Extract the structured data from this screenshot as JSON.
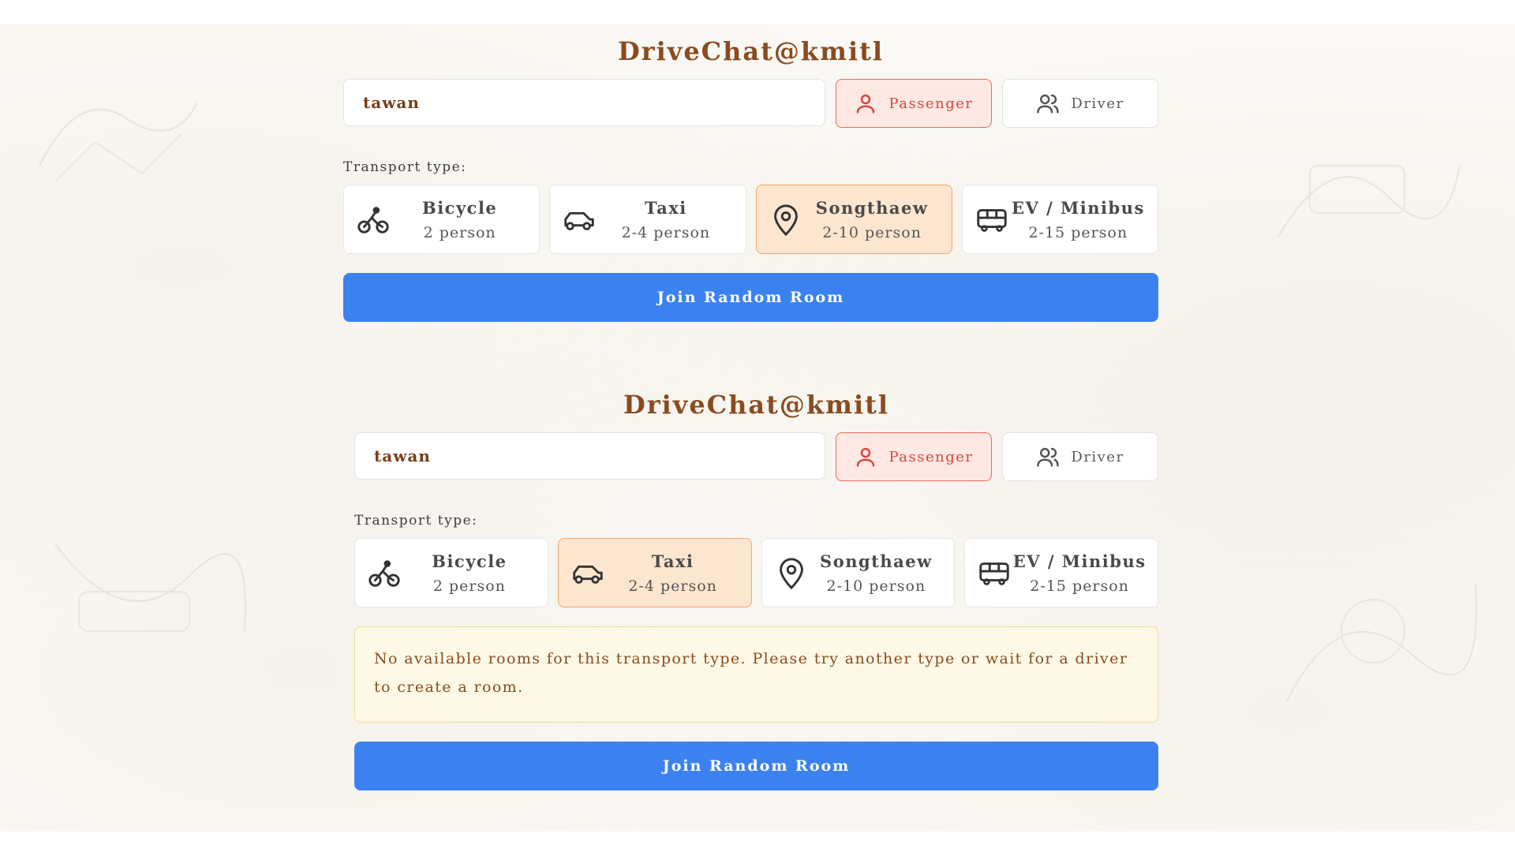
{
  "app_title": "DriveChat@kmitl",
  "colors": {
    "title": "#8a4b1f",
    "accent_blue": "#3b82f0",
    "passenger_active_bg": "#fde8e4",
    "passenger_active_border": "#ef6b5a",
    "transport_active_bg": "#fde6cf",
    "alert_bg": "#fef9e6"
  },
  "panels": [
    {
      "title": "DriveChat@kmitl",
      "name_value": "tawan",
      "roles": [
        {
          "label": "Passenger",
          "icon": "user-icon",
          "active": true
        },
        {
          "label": "Driver",
          "icon": "users-icon",
          "active": false
        }
      ],
      "transport_label": "Transport type:",
      "transports": [
        {
          "name": "Bicycle",
          "capacity": "2 person",
          "icon": "bicycle-icon",
          "active": false
        },
        {
          "name": "Taxi",
          "capacity": "2-4 person",
          "icon": "car-icon",
          "active": false
        },
        {
          "name": "Songthaew",
          "capacity": "2-10 person",
          "icon": "map-pin-icon",
          "active": true
        },
        {
          "name": "EV / Minibus",
          "capacity": "2-15 person",
          "icon": "bus-icon",
          "active": false
        }
      ],
      "join_label": "Join Random Room"
    },
    {
      "title": "DriveChat@kmitl",
      "name_value": "tawan",
      "roles": [
        {
          "label": "Passenger",
          "icon": "user-icon",
          "active": true
        },
        {
          "label": "Driver",
          "icon": "users-icon",
          "active": false
        }
      ],
      "transport_label": "Transport type:",
      "transports": [
        {
          "name": "Bicycle",
          "capacity": "2 person",
          "icon": "bicycle-icon",
          "active": false
        },
        {
          "name": "Taxi",
          "capacity": "2-4 person",
          "icon": "car-icon",
          "active": true
        },
        {
          "name": "Songthaew",
          "capacity": "2-10 person",
          "icon": "map-pin-icon",
          "active": false
        },
        {
          "name": "EV / Minibus",
          "capacity": "2-15 person",
          "icon": "bus-icon",
          "active": false
        }
      ],
      "alert_text": "No available rooms for this transport type. Please try another type or wait for a driver to create a room.",
      "join_label": "Join Random Room"
    }
  ]
}
